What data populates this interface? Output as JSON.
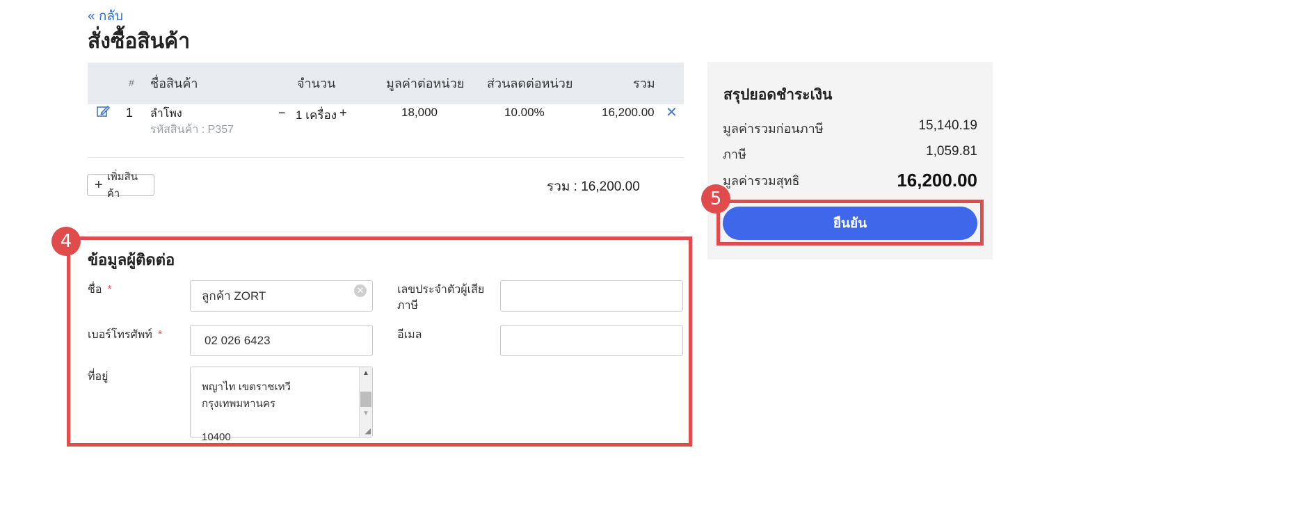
{
  "header": {
    "back_label": "กลับ",
    "title": "สั่งซื้อสินค้า"
  },
  "table": {
    "columns": [
      "#",
      "ชื่อสินค้า",
      "จำนวน",
      "มูลค่าต่อหน่วย",
      "ส่วนลดต่อหน่วย",
      "รวม"
    ],
    "rows": [
      {
        "index": "1",
        "name": "ลำโพง",
        "code": "รหัสสินค้า : P357",
        "qty_minus": "−",
        "qty": "1 เครื่อง",
        "qty_plus": "+",
        "unit_price": "18,000",
        "discount": "10.00%",
        "total": "16,200.00"
      }
    ],
    "add_item_label": "เพิ่มสินค้า",
    "grand_total": "รวม : 16,200.00"
  },
  "contact": {
    "title": "ข้อมูลผู้ติดต่อ",
    "name_label": "ชื่อ",
    "name_value": "ลูกค้า ZORT",
    "required_mark": "*",
    "tax_id_label_line1": "เลขประจำตัวผู้เสีย",
    "tax_id_label_line2": "ภาษี",
    "tax_id_value": "",
    "phone_label": "เบอร์โทรศัพท์",
    "phone_value": "02 026 6423",
    "email_label": "อีเมล",
    "email_value": "",
    "address_label": "ที่อยู่",
    "address_line1": "พญาไท เขตราชเทวี กรุงเทพมหานคร",
    "address_line2": "10400"
  },
  "summary": {
    "title": "สรุปยอดชำระเงิน",
    "subtotal_label": "มูลค่ารวมก่อนภาษี",
    "subtotal_value": "15,140.19",
    "tax_label": "ภาษี",
    "tax_value": "1,059.81",
    "net_label": "มูลค่ารวมสุทธิ",
    "net_value": "16,200.00",
    "confirm_label": "ยืนยัน"
  },
  "annotations": {
    "badge_contact": "4",
    "badge_confirm": "5",
    "color": "#e04b4b"
  },
  "colors": {
    "accent": "#3f67ea",
    "link": "#2f6fd3"
  }
}
